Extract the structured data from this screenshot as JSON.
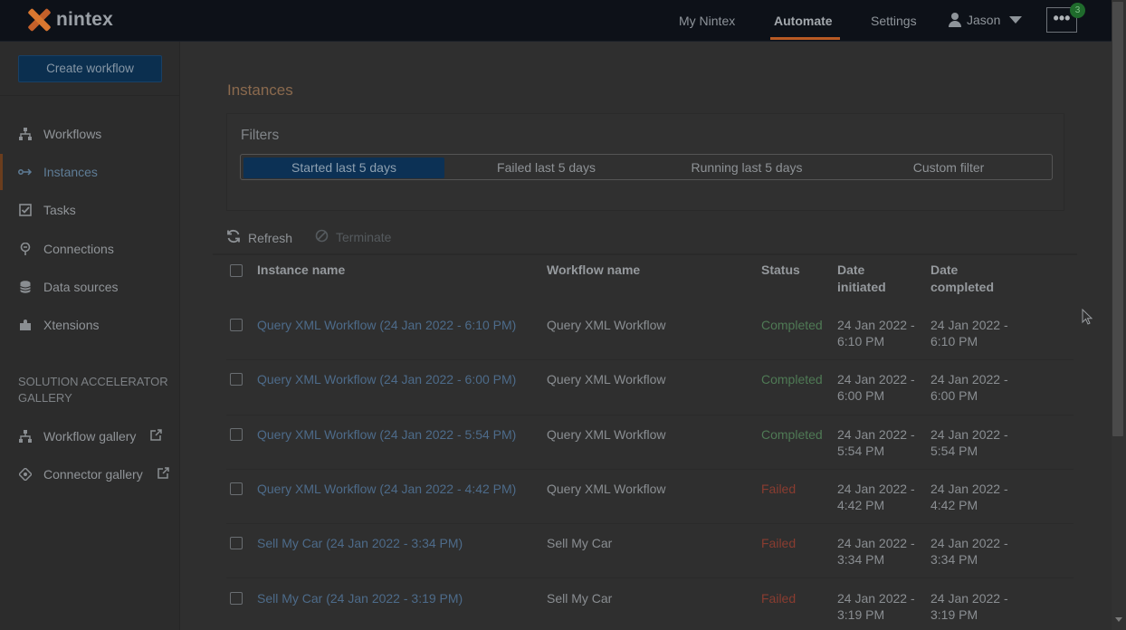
{
  "app": {
    "logo_text": "nintex",
    "nav": {
      "my_nintex": "My Nintex",
      "automate": "Automate",
      "settings": "Settings",
      "user": "Jason"
    },
    "more_label": "•••",
    "badge": "3"
  },
  "sidebar": {
    "create_label": "Create workflow",
    "items": [
      {
        "label": "Workflows",
        "icon": "workflows-icon"
      },
      {
        "label": "Instances",
        "icon": "instances-icon"
      },
      {
        "label": "Tasks",
        "icon": "tasks-icon"
      },
      {
        "label": "Connections",
        "icon": "connections-icon"
      },
      {
        "label": "Data sources",
        "icon": "data-sources-icon"
      },
      {
        "label": "Xtensions",
        "icon": "xtensions-icon"
      }
    ],
    "section_title": "SOLUTION ACCELERATOR GALLERY",
    "gallery": [
      {
        "label": "Workflow gallery",
        "icon": "workflow-gallery-icon"
      },
      {
        "label": "Connector gallery",
        "icon": "connector-gallery-icon"
      }
    ]
  },
  "main": {
    "title": "Instances",
    "filters": {
      "label": "Filters",
      "options": [
        "Started last 5 days",
        "Failed last 5 days",
        "Running last 5 days",
        "Custom filter"
      ],
      "selected": "Started last 5 days"
    },
    "toolbar": {
      "refresh": "Refresh",
      "terminate": "Terminate"
    },
    "table": {
      "headers": {
        "instance": "Instance name",
        "workflow": "Workflow name",
        "status": "Status",
        "initiated_1": "Date",
        "initiated_2": "initiated",
        "completed_1": "Date",
        "completed_2": "completed"
      },
      "rows": [
        {
          "instance": "Query XML Workflow (24 Jan 2022 - 6:10 PM)",
          "workflow": "Query XML Workflow",
          "status": "Completed",
          "init_1": "24 Jan 2022 -",
          "init_2": "6:10 PM",
          "comp_1": "24 Jan 2022 -",
          "comp_2": "6:10 PM"
        },
        {
          "instance": "Query XML Workflow (24 Jan 2022 - 6:00 PM)",
          "workflow": "Query XML Workflow",
          "status": "Completed",
          "init_1": "24 Jan 2022 -",
          "init_2": "6:00 PM",
          "comp_1": "24 Jan 2022 -",
          "comp_2": "6:00 PM"
        },
        {
          "instance": "Query XML Workflow (24 Jan 2022 - 5:54 PM)",
          "workflow": "Query XML Workflow",
          "status": "Completed",
          "init_1": "24 Jan 2022 -",
          "init_2": "5:54 PM",
          "comp_1": "24 Jan 2022 -",
          "comp_2": "5:54 PM"
        },
        {
          "instance": "Query XML Workflow (24 Jan 2022 - 4:42 PM)",
          "workflow": "Query XML Workflow",
          "status": "Failed",
          "init_1": "24 Jan 2022 -",
          "init_2": "4:42 PM",
          "comp_1": "24 Jan 2022 -",
          "comp_2": "4:42 PM"
        },
        {
          "instance": "Sell My Car (24 Jan 2022 - 3:34 PM)",
          "workflow": "Sell My Car",
          "status": "Failed",
          "init_1": "24 Jan 2022 -",
          "init_2": "3:34 PM",
          "comp_1": "24 Jan 2022 -",
          "comp_2": "3:34 PM"
        },
        {
          "instance": "Sell My Car (24 Jan 2022 - 3:19 PM)",
          "workflow": "Sell My Car",
          "status": "Failed",
          "init_1": "24 Jan 2022 -",
          "init_2": "3:19 PM",
          "comp_1": "24 Jan 2022 -",
          "comp_2": "3:19 PM"
        }
      ]
    }
  },
  "colors": {
    "accent": "#b85a24",
    "completed": "#4f7a55",
    "failed": "#8a3c30",
    "link": "#4d6b8a"
  }
}
